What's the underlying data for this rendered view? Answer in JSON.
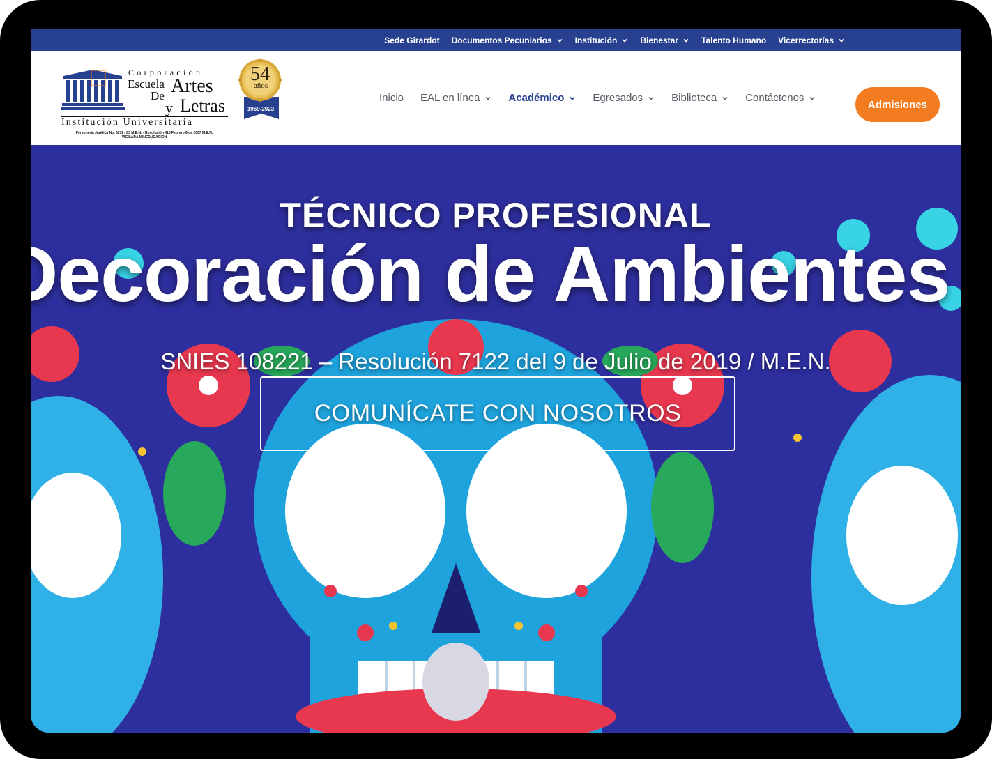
{
  "topbar": {
    "items": [
      {
        "label": "Sede Girardot",
        "dropdown": false
      },
      {
        "label": "Documentos Pecuniarios",
        "dropdown": true
      },
      {
        "label": "Institución",
        "dropdown": true
      },
      {
        "label": "Bienestar",
        "dropdown": true
      },
      {
        "label": "Talento Humano",
        "dropdown": false
      },
      {
        "label": "Vicerrectorías",
        "dropdown": true
      }
    ]
  },
  "logo": {
    "corporacion": "Corporación",
    "escuela": "Escuela",
    "de": "De",
    "artes": "Artes",
    "y": "y",
    "letras": "Letras",
    "institucion": "Institución Universitaria",
    "legal_line1": "Personería Jurídica No. 6272 / 83 M.E.N. - Resolución 415 Febrero 6 de 2007 M.E.N.",
    "legal_line2": "VIGILADA MINEDUCACIÓN"
  },
  "badge": {
    "number": "54",
    "unit": "años",
    "years": "1969-2023"
  },
  "nav": {
    "items": [
      {
        "label": "Inicio",
        "dropdown": false,
        "active": false
      },
      {
        "label": "EAL en línea",
        "dropdown": true,
        "active": false
      },
      {
        "label": "Académico",
        "dropdown": true,
        "active": true
      },
      {
        "label": "Egresados",
        "dropdown": true,
        "active": false
      },
      {
        "label": "Biblioteca",
        "dropdown": true,
        "active": false
      },
      {
        "label": "Contáctenos",
        "dropdown": true,
        "active": false
      }
    ],
    "cta": "Admisiones"
  },
  "hero": {
    "kicker": "TÉCNICO PROFESIONAL",
    "title": "Decoración de Ambientes",
    "subtitle": "SNIES 108221 – Resolución 7122 del 9 de Julio de 2019 / M.E.N.",
    "cta": "COMUNÍCATE CON NOSOTROS"
  },
  "colors": {
    "topbar": "#27408f",
    "accent": "#f47c20",
    "nav_active": "#27408f",
    "hero_bg": "#2e2f9f"
  }
}
